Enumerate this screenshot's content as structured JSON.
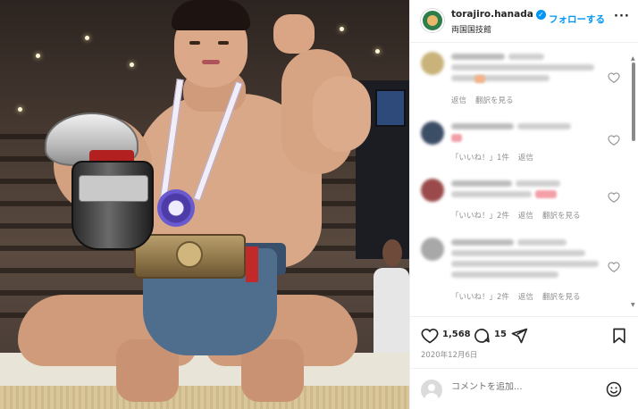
{
  "post": {
    "username": "torajiro.hanada",
    "location": "両国国技館",
    "follow_label": "フォローする",
    "more_label": "···",
    "verified_mark": "✓"
  },
  "comments": [
    {
      "actions": [
        "返信",
        "翻訳を見る"
      ]
    },
    {
      "actions": [
        "「いいね！」1件",
        "返信"
      ]
    },
    {
      "actions": [
        "「いいね！」2件",
        "返信",
        "翻訳を見る"
      ]
    },
    {
      "actions": [
        "「いいね！」2件",
        "返信",
        "翻訳を見る"
      ]
    }
  ],
  "stats": {
    "likes": "1,568",
    "comments": "15",
    "date": "2020年12月6日"
  },
  "add_comment": {
    "placeholder": "コメントを追加..."
  },
  "colors": {
    "accent": "#0095f6",
    "secondary_text": "#8e8e8e",
    "border": "#efefef"
  },
  "icons": [
    "heart-icon",
    "comment-icon",
    "share-icon",
    "bookmark-icon",
    "emoji-icon",
    "verified-icon",
    "more-icon"
  ]
}
